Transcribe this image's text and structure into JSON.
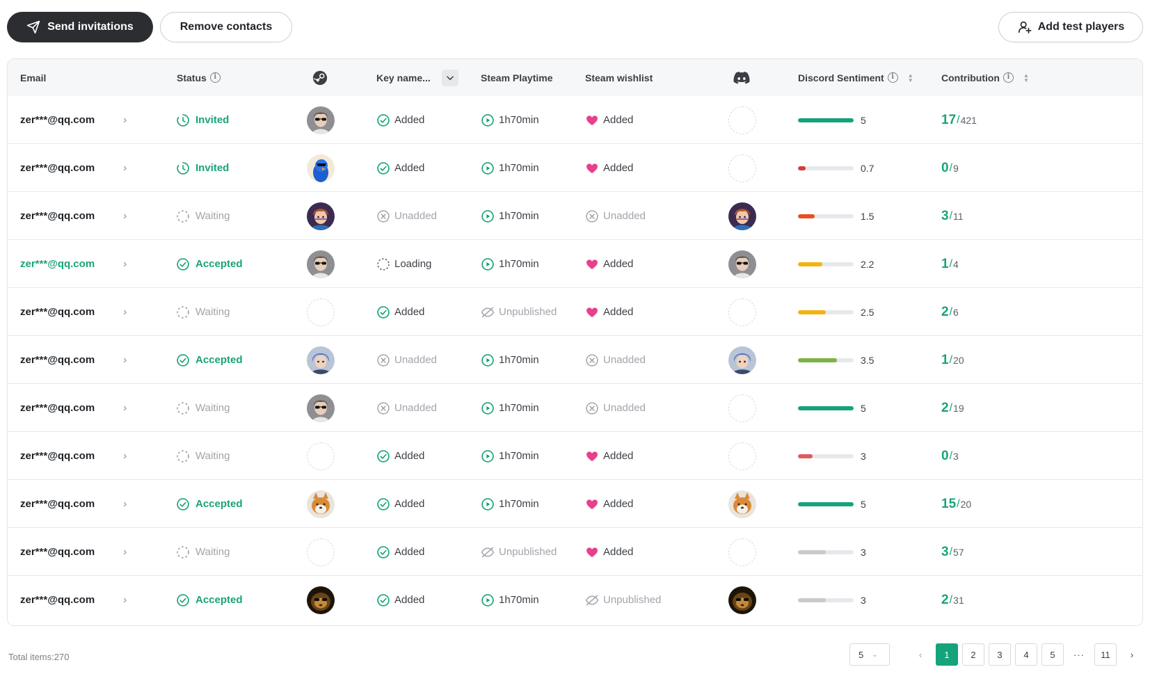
{
  "toolbar": {
    "send_label": "Send invitations",
    "remove_label": "Remove contacts",
    "add_label": "Add test players"
  },
  "columns": {
    "email": "Email",
    "status": "Status",
    "key": "Key name...",
    "playtime": "Steam Playtime",
    "wishlist": "Steam wishlist",
    "sentiment": "Discord Sentiment",
    "contribution": "Contribution"
  },
  "colors": {
    "accent": "#1aa37a",
    "primary_dark": "#2b2d31",
    "wishlist_heart": "#e8408a",
    "muted": "#a0a4aa"
  },
  "rows": [
    {
      "email": "zer***@qq.com",
      "email_highlight": false,
      "status": "Invited",
      "status_type": "invited",
      "steam_avatar": "avatar-glasses-man",
      "key": "Added",
      "key_type": "added",
      "playtime": "1h70min",
      "playtime_type": "play",
      "wishlist": "Added",
      "wishlist_type": "heart",
      "discord_avatar": "empty",
      "sentiment": 5,
      "sentiment_label": "5",
      "sentiment_color": "#14a37a",
      "contribution": "17",
      "contribution_total": "421"
    },
    {
      "email": "zer***@qq.com",
      "email_highlight": false,
      "status": "Invited",
      "status_type": "invited",
      "steam_avatar": "avatar-blue-bird",
      "key": "Added",
      "key_type": "added",
      "playtime": "1h70min",
      "playtime_type": "play",
      "wishlist": "Added",
      "wishlist_type": "heart",
      "discord_avatar": "empty",
      "sentiment": 0.7,
      "sentiment_label": "0.7",
      "sentiment_color": "#d93a3a",
      "contribution": "0",
      "contribution_total": "9"
    },
    {
      "email": "zer***@qq.com",
      "email_highlight": false,
      "status": "Waiting",
      "status_type": "waiting",
      "steam_avatar": "avatar-anime-boy",
      "key": "Unadded",
      "key_type": "unadded",
      "playtime": "1h70min",
      "playtime_type": "play",
      "wishlist": "Unadded",
      "wishlist_type": "unadded",
      "discord_avatar": "avatar-anime-boy",
      "sentiment": 1.5,
      "sentiment_label": "1.5",
      "sentiment_color": "#e8501e",
      "contribution": "3",
      "contribution_total": "11"
    },
    {
      "email": "zer***@qq.com",
      "email_highlight": true,
      "status": "Accepted",
      "status_type": "accepted",
      "steam_avatar": "avatar-glasses-man",
      "key": "Loading",
      "key_type": "loading",
      "playtime": "1h70min",
      "playtime_type": "play",
      "wishlist": "Added",
      "wishlist_type": "heart",
      "discord_avatar": "avatar-glasses-man",
      "sentiment": 2.2,
      "sentiment_label": "2.2",
      "sentiment_color": "#f5b30f",
      "contribution": "1",
      "contribution_total": "4"
    },
    {
      "email": "zer***@qq.com",
      "email_highlight": false,
      "status": "Waiting",
      "status_type": "waiting",
      "steam_avatar": "empty",
      "key": "Added",
      "key_type": "added",
      "playtime": "Unpublished",
      "playtime_type": "unpublished",
      "wishlist": "Added",
      "wishlist_type": "heart",
      "discord_avatar": "empty",
      "sentiment": 2.5,
      "sentiment_label": "2.5",
      "sentiment_color": "#f5b30f",
      "contribution": "2",
      "contribution_total": "6"
    },
    {
      "email": "zer***@qq.com",
      "email_highlight": false,
      "status": "Accepted",
      "status_type": "accepted",
      "steam_avatar": "avatar-blue-hair",
      "key": "Unadded",
      "key_type": "unadded",
      "playtime": "1h70min",
      "playtime_type": "play",
      "wishlist": "Unadded",
      "wishlist_type": "unadded",
      "discord_avatar": "avatar-blue-hair",
      "sentiment": 3.5,
      "sentiment_label": "3.5",
      "sentiment_color": "#7cb342",
      "contribution": "1",
      "contribution_total": "20"
    },
    {
      "email": "zer***@qq.com",
      "email_highlight": false,
      "status": "Waiting",
      "status_type": "waiting",
      "steam_avatar": "avatar-glasses-man",
      "key": "Unadded",
      "key_type": "unadded",
      "playtime": "1h70min",
      "playtime_type": "play",
      "wishlist": "Unadded",
      "wishlist_type": "unadded",
      "discord_avatar": "empty",
      "sentiment": 5,
      "sentiment_label": "5",
      "sentiment_color": "#14a37a",
      "contribution": "2",
      "contribution_total": "19"
    },
    {
      "email": "zer***@qq.com",
      "email_highlight": false,
      "status": "Waiting",
      "status_type": "waiting",
      "steam_avatar": "empty",
      "key": "Added",
      "key_type": "added",
      "playtime": "1h70min",
      "playtime_type": "play",
      "wishlist": "Added",
      "wishlist_type": "heart",
      "discord_avatar": "empty",
      "sentiment": 1.3,
      "sentiment_label": "3",
      "sentiment_color": "#e25a5a",
      "contribution": "0",
      "contribution_total": "3"
    },
    {
      "email": "zer***@qq.com",
      "email_highlight": false,
      "status": "Accepted",
      "status_type": "accepted",
      "steam_avatar": "avatar-shiba",
      "key": "Added",
      "key_type": "added",
      "playtime": "1h70min",
      "playtime_type": "play",
      "wishlist": "Added",
      "wishlist_type": "heart",
      "discord_avatar": "avatar-shiba",
      "sentiment": 5,
      "sentiment_label": "5",
      "sentiment_color": "#14a37a",
      "contribution": "15",
      "contribution_total": "20"
    },
    {
      "email": "zer***@qq.com",
      "email_highlight": false,
      "status": "Waiting",
      "status_type": "waiting",
      "steam_avatar": "empty",
      "key": "Added",
      "key_type": "added",
      "playtime": "Unpublished",
      "playtime_type": "unpublished",
      "wishlist": "Added",
      "wishlist_type": "heart",
      "discord_avatar": "empty",
      "sentiment": 2.5,
      "sentiment_label": "3",
      "sentiment_color": "#c8cacd",
      "contribution": "3",
      "contribution_total": "57"
    },
    {
      "email": "zer***@qq.com",
      "email_highlight": false,
      "status": "Accepted",
      "status_type": "accepted",
      "steam_avatar": "avatar-monkey",
      "key": "Added",
      "key_type": "added",
      "playtime": "1h70min",
      "playtime_type": "play",
      "wishlist": "Unpublished",
      "wishlist_type": "unpublished",
      "discord_avatar": "avatar-monkey",
      "sentiment": 2.5,
      "sentiment_label": "3",
      "sentiment_color": "#c8cacd",
      "contribution": "2",
      "contribution_total": "31"
    }
  ],
  "footer": {
    "total": "Total items:270",
    "page_size": "5",
    "pages": [
      "1",
      "2",
      "3",
      "4",
      "5"
    ],
    "ellipsis": "···",
    "last_page": "11",
    "current_page": "1"
  }
}
